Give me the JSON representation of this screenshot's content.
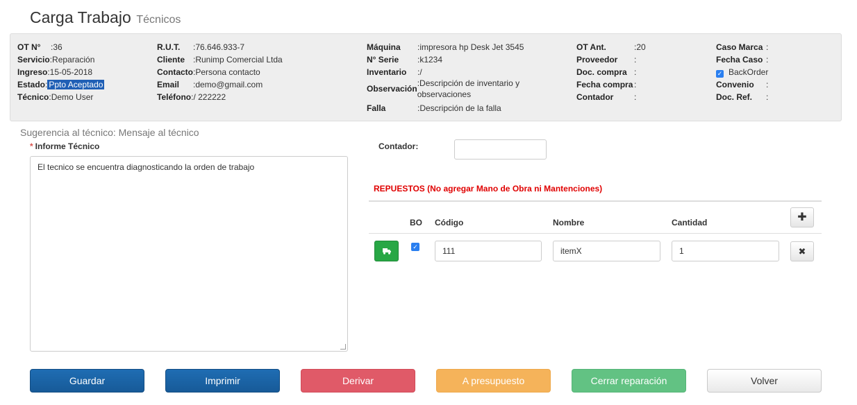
{
  "header": {
    "title": "Carga Trabajo",
    "subtitle": "Técnicos"
  },
  "info": {
    "col1": [
      {
        "label": "OT N°",
        "value": ":36"
      },
      {
        "label": "Servicio",
        "value": ":Reparación"
      },
      {
        "label": "Ingreso",
        "value": ":15-05-2018"
      },
      {
        "label": "Estado",
        "sep": ":",
        "value": "Ppto Aceptado"
      },
      {
        "label": "Técnico",
        "value": ":Demo User"
      }
    ],
    "col2": [
      {
        "label": "R.U.T.",
        "value": ":76.646.933-7"
      },
      {
        "label": "Cliente",
        "value": ":Runimp Comercial Ltda"
      },
      {
        "label": "Contacto",
        "value": ":Persona contacto"
      },
      {
        "label": "Email",
        "value": ":demo@gmail.com"
      },
      {
        "label": "Teléfono",
        "value": ":/ 222222"
      }
    ],
    "col3": [
      {
        "label": "Máquina",
        "value": ":impresora hp Desk Jet 3545"
      },
      {
        "label": "N° Serie",
        "value": ":k1234"
      },
      {
        "label": "Inventario",
        "value": ":/"
      },
      {
        "label": "Observación",
        "value": ":Descripción de inventario y observaciones"
      },
      {
        "label": "Falla",
        "value": ":Descripción de la falla"
      }
    ],
    "col4": [
      {
        "label": "OT Ant.",
        "value": ":20"
      },
      {
        "label": "Proveedor",
        "value": ":"
      },
      {
        "label": "Doc. compra",
        "value": ":"
      },
      {
        "label": "Fecha compra",
        "value": ":"
      },
      {
        "label": "Contador",
        "value": ":"
      }
    ],
    "col5": [
      {
        "label": "Caso Marca",
        "value": ":"
      },
      {
        "label": "Fecha Caso",
        "value": ":"
      },
      {
        "label": "",
        "value": "BackOrder",
        "checked": true
      },
      {
        "label": "Convenio",
        "value": ":"
      },
      {
        "label": "Doc. Ref.",
        "value": ":"
      }
    ]
  },
  "suggestion": "Sugerencia al técnico: Mensaje al técnico",
  "informe": {
    "required_mark": "*",
    "label": "Informe Técnico",
    "value": "El tecnico se encuentra diagnosticando la orden de trabajo"
  },
  "contador": {
    "label": "Contador:",
    "value": ""
  },
  "repuestos": {
    "title": "REPUESTOS (No agregar Mano de Obra ni Mantenciones)",
    "columns": [
      "BO",
      "Código",
      "Nombre",
      "Cantidad"
    ],
    "rows": [
      {
        "bo": true,
        "codigo": "111",
        "nombre": "itemX",
        "cantidad": "1"
      }
    ],
    "add_icon": "plus-icon",
    "remove_icon": "close-icon",
    "row_action_icon": "truck-icon"
  },
  "buttons": {
    "guardar": "Guardar",
    "imprimir": "Imprimir",
    "derivar": "Derivar",
    "presupuesto": "A presupuesto",
    "cerrar": "Cerrar reparación",
    "volver": "Volver"
  },
  "colors": {
    "primary": "#1f6db3",
    "danger": "#e05a68",
    "warning": "#f5b35a",
    "success": "#62c283",
    "repuestos_title": "#e00000",
    "highlight": "#1f5fb5"
  }
}
